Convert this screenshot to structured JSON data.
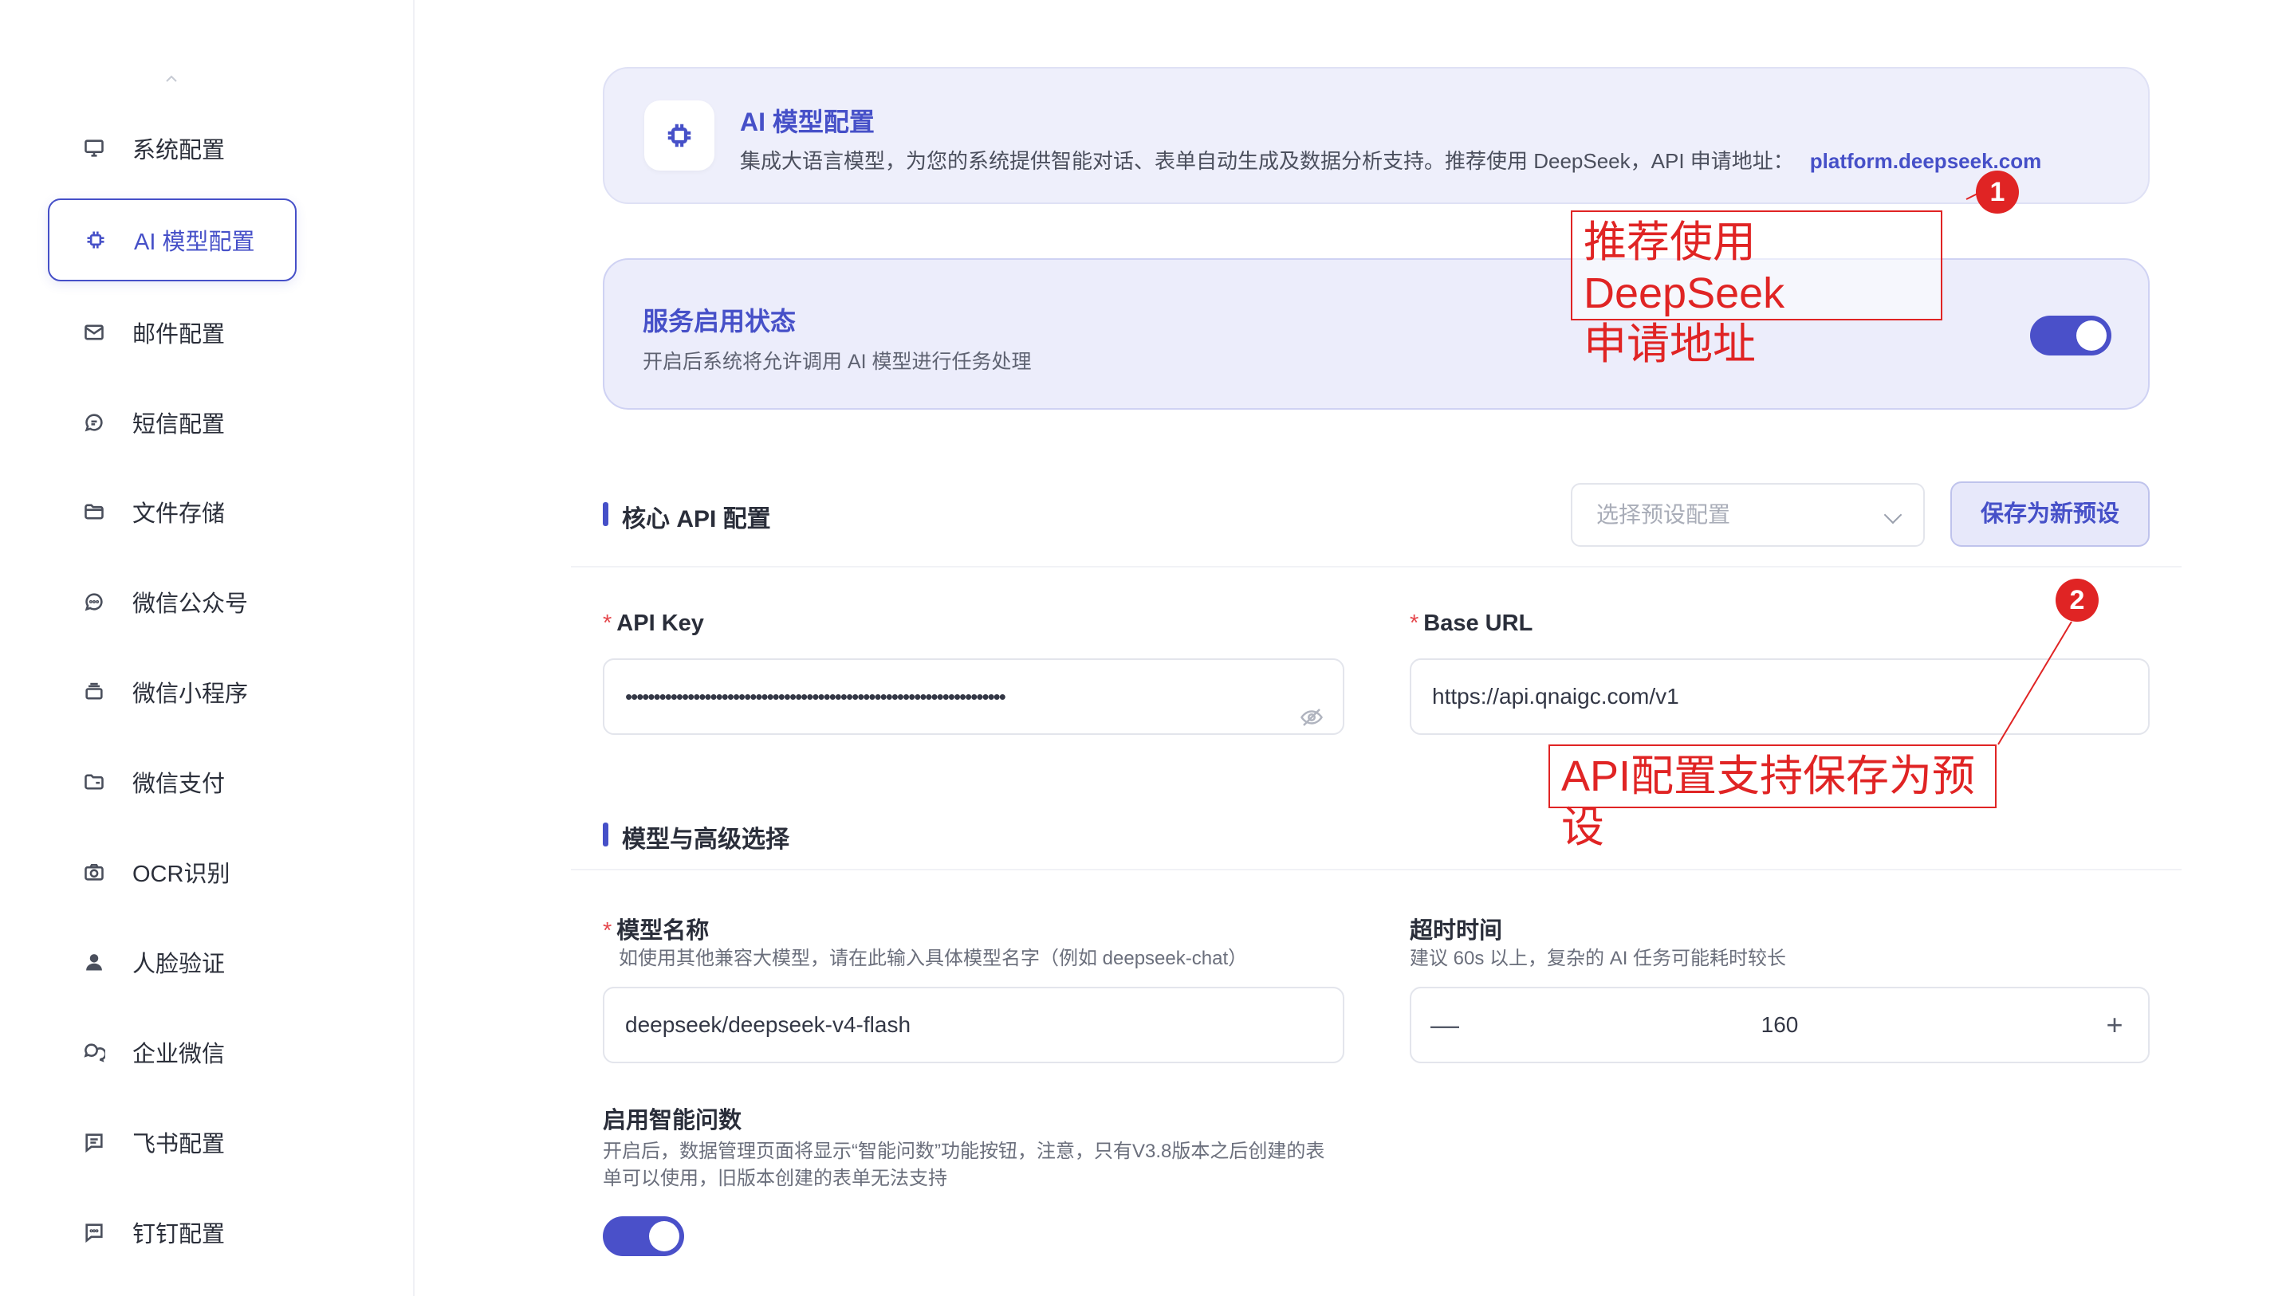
{
  "sidebar": {
    "items": [
      {
        "label": "系统配置",
        "icon": "monitor-icon",
        "active": false
      },
      {
        "label": "AI 模型配置",
        "icon": "chip-icon",
        "active": true
      },
      {
        "label": "邮件配置",
        "icon": "mail-icon",
        "active": false
      },
      {
        "label": "短信配置",
        "icon": "chat-bubble-icon",
        "active": false
      },
      {
        "label": "文件存储",
        "icon": "folder-icon",
        "active": false
      },
      {
        "label": "微信公众号",
        "icon": "message-dots-icon",
        "active": false
      },
      {
        "label": "微信小程序",
        "icon": "layers-icon",
        "active": false
      },
      {
        "label": "微信支付",
        "icon": "wallet-folder-icon",
        "active": false
      },
      {
        "label": "OCR识别",
        "icon": "camera-icon",
        "active": false
      },
      {
        "label": "人脸验证",
        "icon": "user-icon",
        "active": false
      },
      {
        "label": "企业微信",
        "icon": "chat-multi-icon",
        "active": false
      },
      {
        "label": "飞书配置",
        "icon": "message-lines-icon",
        "active": false
      },
      {
        "label": "钉钉配置",
        "icon": "message-square-icon",
        "active": false
      }
    ]
  },
  "header_card": {
    "title": "AI 模型配置",
    "description": "集成大语言模型，为您的系统提供智能对话、表单自动生成及数据分析支持。推荐使用 DeepSeek，API 申请地址：",
    "link": "platform.deepseek.com"
  },
  "service_card": {
    "title": "服务启用状态",
    "description": "开启后系统将允许调用 AI 模型进行任务处理",
    "enabled": true
  },
  "core_api": {
    "section_title": "核心 API 配置",
    "preset_placeholder": "选择预设配置",
    "save_preset_label": "保存为新预设",
    "api_key_label": "API Key",
    "api_key_value": "•••••••••••••••••••••••••••••••••••••••••••••••••••••••••••••••••••",
    "base_url_label": "Base URL",
    "base_url_value": "https://api.qnaigc.com/v1"
  },
  "model_section": {
    "section_title": "模型与高级选择",
    "model_name_label": "模型名称",
    "model_name_hint": "如使用其他兼容大模型，请在此输入具体模型名字（例如 deepseek-chat）",
    "model_name_value": "deepseek/deepseek-v4-flash",
    "timeout_label": "超时时间",
    "timeout_hint": "建议 60s 以上，复杂的 AI 任务可能耗时较长",
    "timeout_value": "160",
    "minus": "—",
    "plus": "+",
    "smart_label": "启用智能问数",
    "smart_hint_line1": "开启后，数据管理页面将显示“智能问数”功能按钮，注意，只有V3.8版本之后创建的表",
    "smart_hint_line2": "单可以使用，旧版本创建的表单无法支持",
    "smart_enabled": true
  },
  "annotations": {
    "one_number": "1",
    "one_line1": "推荐使用 DeepSeek",
    "one_line2": "申请地址",
    "two_number": "2",
    "two_text": "API配置支持保存为预设",
    "color": "#e02424"
  }
}
